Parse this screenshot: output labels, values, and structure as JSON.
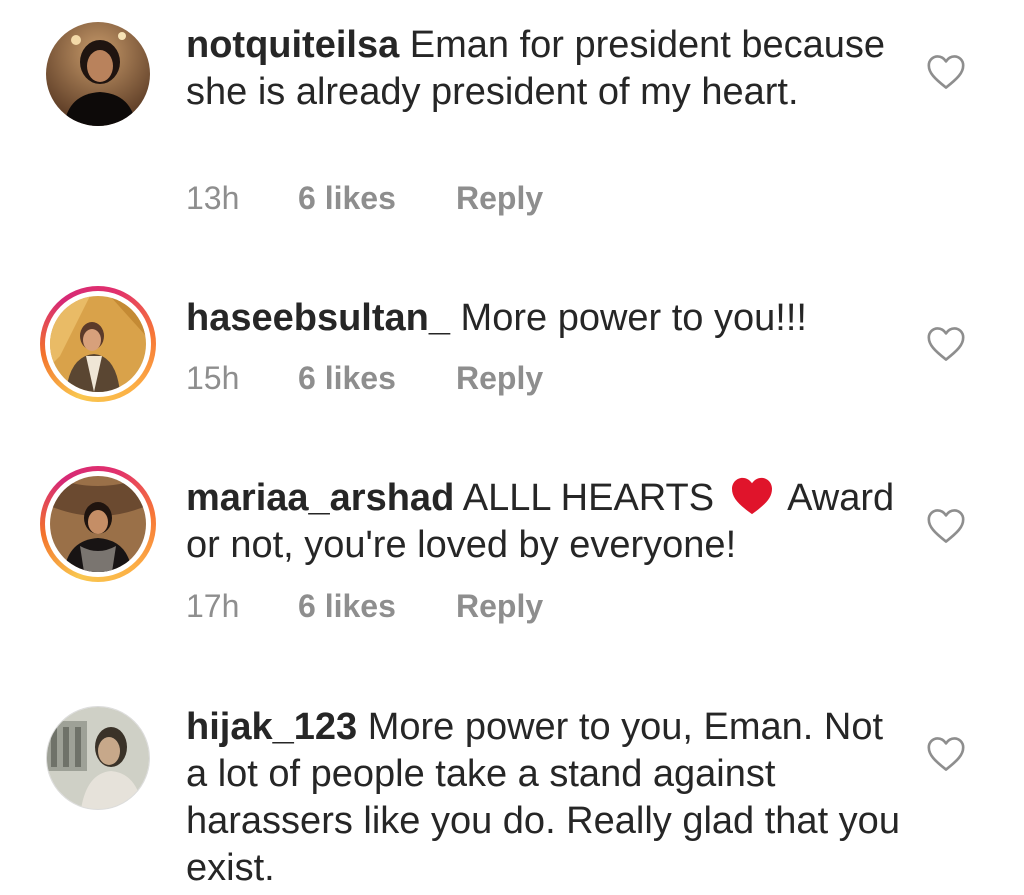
{
  "comments": [
    {
      "username": "notquiteilsa",
      "text": " Eman for president because she is already president of my heart.",
      "time": "13h",
      "likes": "6 likes",
      "reply": "Reply",
      "has_story_ring": false
    },
    {
      "username": "haseebsultan_",
      "text": " More power to you!!!",
      "time": "15h",
      "likes": "6 likes",
      "reply": "Reply",
      "has_story_ring": true
    },
    {
      "username": "mariaa_arshad",
      "text_before_emoji": " ALLL HEARTS ",
      "emoji": "red-heart-emoji",
      "text_after_emoji": " Award or not, you're loved by everyone!",
      "time": "17h",
      "likes": "6 likes",
      "reply": "Reply",
      "has_story_ring": true
    },
    {
      "username": "hijak_123",
      "text": " More power to you, Eman. Not a lot of people take a stand against harassers like you do. Really glad that you exist.",
      "has_story_ring": false
    }
  ],
  "icons": {
    "like": "heart-outline-icon"
  },
  "colors": {
    "text": "#262626",
    "meta": "#8e8e8e",
    "heart_outline": "#8e8e8e",
    "emoji_heart": "#e0142b",
    "story_ring_start": "#fcaf45",
    "story_ring_end": "#d62976"
  }
}
